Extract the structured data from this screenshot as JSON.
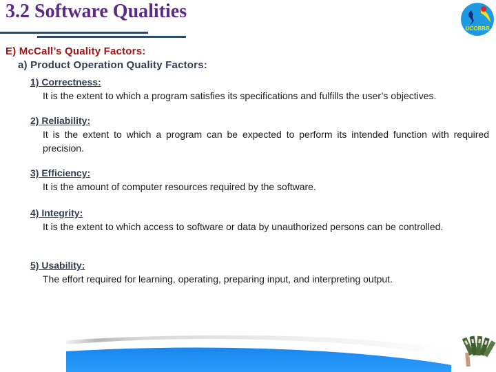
{
  "slide": {
    "title": "3.2 Software Qualities",
    "logo_text": "UCCBBB",
    "section_heading": "E) McCall’s Quality Factors:",
    "sub_heading": "a) Product Operation Quality Factors:",
    "factors": [
      {
        "title": "1) Correctness:",
        "description": "It is the extent to which a program satisfies its specifications and fulfills the user’s objectives."
      },
      {
        "title": "2) Reliability:",
        "description": "It is the extent to which a program can be expected to perform its intended function with required precision."
      },
      {
        "title": "3) Efficiency:",
        "description": "It is the amount of computer resources required by the software."
      },
      {
        "title": "4) Integrity:",
        "description": "It is the extent to which access to software or data by unauthorized persons can be controlled."
      },
      {
        "title": "5) Usability:",
        "description": "The effort required for learning, operating, preparing input, and interpreting output."
      }
    ]
  },
  "colors": {
    "title": "#5b2a86",
    "section_heading": "#a01414",
    "sub_heading": "#2e3e52",
    "rule": "#2e4a66",
    "footer_band": "#1e8cf0",
    "logo_bg": "#1e9be0"
  }
}
